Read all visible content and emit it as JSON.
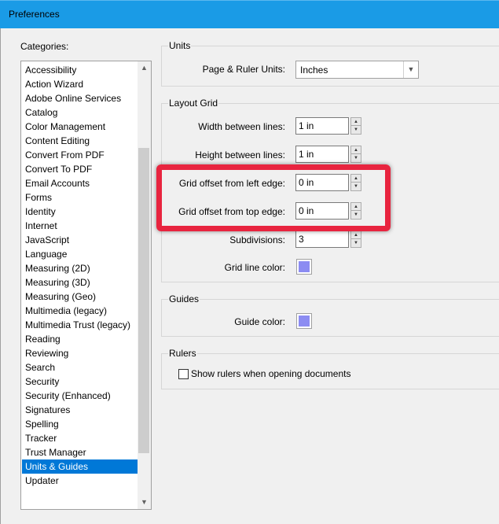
{
  "window": {
    "title": "Preferences"
  },
  "categories": {
    "label": "Categories:",
    "items": [
      "Accessibility",
      "Action Wizard",
      "Adobe Online Services",
      "Catalog",
      "Color Management",
      "Content Editing",
      "Convert From PDF",
      "Convert To PDF",
      "Email Accounts",
      "Forms",
      "Identity",
      "Internet",
      "JavaScript",
      "Language",
      "Measuring (2D)",
      "Measuring (3D)",
      "Measuring (Geo)",
      "Multimedia (legacy)",
      "Multimedia Trust (legacy)",
      "Reading",
      "Reviewing",
      "Search",
      "Security",
      "Security (Enhanced)",
      "Signatures",
      "Spelling",
      "Tracker",
      "Trust Manager",
      "Units & Guides",
      "Updater"
    ],
    "selected": "Units & Guides"
  },
  "units": {
    "title": "Units",
    "page_ruler_label": "Page & Ruler Units:",
    "page_ruler_value": "Inches"
  },
  "layout_grid": {
    "title": "Layout Grid",
    "width_label": "Width between lines:",
    "width_value": "1 in",
    "height_label": "Height between lines:",
    "height_value": "1 in",
    "offset_left_label": "Grid offset from left edge:",
    "offset_left_value": "0 in",
    "offset_top_label": "Grid offset from top edge:",
    "offset_top_value": "0 in",
    "subdivisions_label": "Subdivisions:",
    "subdivisions_value": "3",
    "grid_color_label": "Grid line color:",
    "grid_color": "#8c8cf2"
  },
  "guides": {
    "title": "Guides",
    "color_label": "Guide color:",
    "color": "#8c8cf2"
  },
  "rulers": {
    "title": "Rulers",
    "show_rulers_label": "Show rulers when opening documents",
    "show_rulers_checked": false
  },
  "annotation": {
    "highlight_color": "#e8243f"
  }
}
